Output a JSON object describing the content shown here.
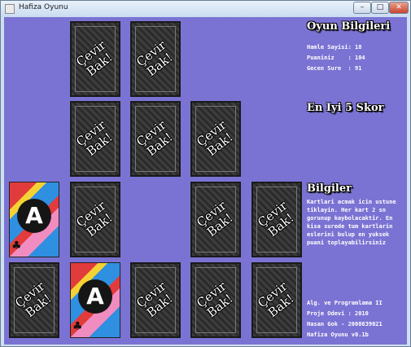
{
  "window": {
    "title": "Hafiza Oyunu",
    "minimize_label": "–",
    "maximize_label": "□",
    "close_label": "✕"
  },
  "colors": {
    "background": "#7b73d3",
    "card_back": "#3d3d3d",
    "text": "#ffffff"
  },
  "cards": [
    {
      "state": "back",
      "label_line1": "Çevir",
      "label_line2": "Bak!"
    },
    {
      "state": "back",
      "label_line1": "Çevir",
      "label_line2": "Bak!"
    },
    {
      "state": "back",
      "label_line1": "Çevir",
      "label_line2": "Bak!"
    },
    {
      "state": "back",
      "label_line1": "Çevir",
      "label_line2": "Bak!"
    },
    {
      "state": "back",
      "label_line1": "Çevir",
      "label_line2": "Bak!"
    },
    {
      "state": "face",
      "rank": "A",
      "suit": "♣"
    },
    {
      "state": "back",
      "label_line1": "Çevir",
      "label_line2": "Bak!"
    },
    {
      "state": "back",
      "label_line1": "Çevir",
      "label_line2": "Bak!"
    },
    {
      "state": "back",
      "label_line1": "Çevir",
      "label_line2": "Bak!"
    },
    {
      "state": "back",
      "label_line1": "Çevir",
      "label_line2": "Bak!"
    },
    {
      "state": "face",
      "rank": "A",
      "suit": "♣"
    },
    {
      "state": "back",
      "label_line1": "Çevir",
      "label_line2": "Bak!"
    },
    {
      "state": "back",
      "label_line1": "Çevir",
      "label_line2": "Bak!"
    },
    {
      "state": "back",
      "label_line1": "Çevir",
      "label_line2": "Bak!"
    }
  ],
  "game_info": {
    "title": "Oyun Bilgileri",
    "moves_line": "Hamle Sayisi: 18",
    "score_line": "Puaniniz    : 104",
    "time_line": "Gecen Sure  : 91"
  },
  "top_scores": {
    "title": "En Iyi 5 Skor"
  },
  "info": {
    "title": "Bilgiler",
    "text": "Kartlari acmak icin ustune tiklayin. Her kart 2 sn gorunup kaybolacaktir. En kisa surede tum kartlarin eslerini bulup en yuksek puani toplayabilirsiniz"
  },
  "footer": {
    "line1": "Alg. ve Programlama II",
    "line2": "Proje Odevi : 2010",
    "line3": "Hasan Gok - 2008639021",
    "line4": "Hafiza Oyunu v0.1b"
  }
}
